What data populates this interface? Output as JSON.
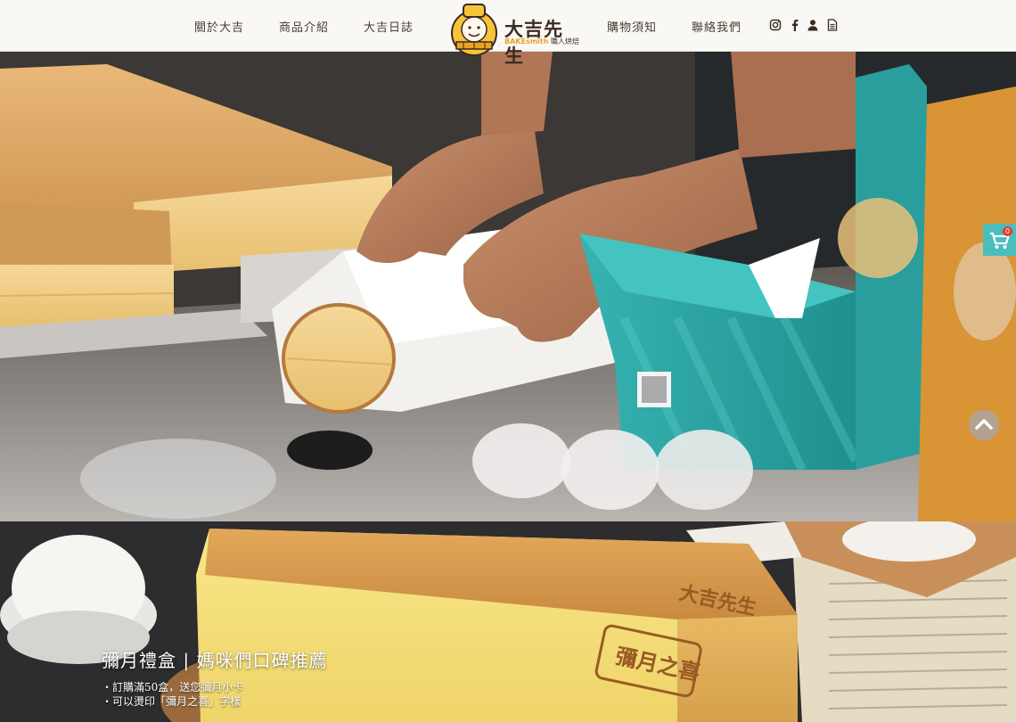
{
  "nav": {
    "about": "關於大吉",
    "products": "商品介紹",
    "journal": "大吉日誌",
    "shopping": "購物須知",
    "contact": "聯絡我們"
  },
  "logo": {
    "title": "大吉先生",
    "sub_brand": "BAKEsmith",
    "sub_text": "職人烘焙"
  },
  "social": {
    "icons": [
      "instagram-icon",
      "facebook-icon",
      "user-icon",
      "document-icon"
    ]
  },
  "cart": {
    "count": "0",
    "icon": "cart-icon"
  },
  "scroll_top": {
    "icon": "chevron-up-icon"
  },
  "hero2": {
    "title": "彌月禮盒 | 媽咪們口碑推薦",
    "bullets": [
      "・訂購滿50盒，送您彌月小卡",
      "・可以燙印「彌月之喜」字樣"
    ],
    "cake_text": "大吉先生",
    "stamp_text": "彌月之喜"
  },
  "colors": {
    "header_bg": "#faf8f5",
    "nav_text": "#4a3b30",
    "brand_yellow": "#e8a323",
    "cart_teal": "#4bbdbd",
    "badge_red": "#e33b2e"
  }
}
